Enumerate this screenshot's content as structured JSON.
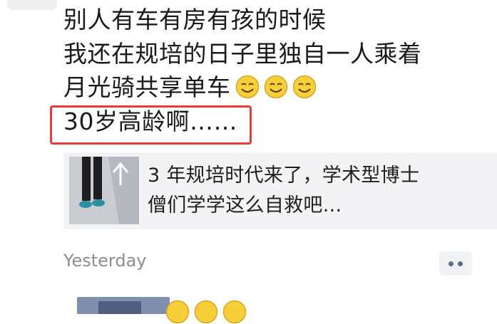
{
  "post": {
    "line1": "别人有车有房有孩的时候",
    "line2": "我还在规培的日子里独自一人乘着",
    "line3": "月光骑共享单车",
    "line4": "30岁高龄啊……",
    "emoji": "smiley-icon",
    "highlight_color": "#e83a3a"
  },
  "link_card": {
    "title_line1": "3 年规培时代来了，学术型博士",
    "title_line2": "僧们学学这么自救吧..."
  },
  "meta": {
    "timestamp": "Yesterday"
  }
}
